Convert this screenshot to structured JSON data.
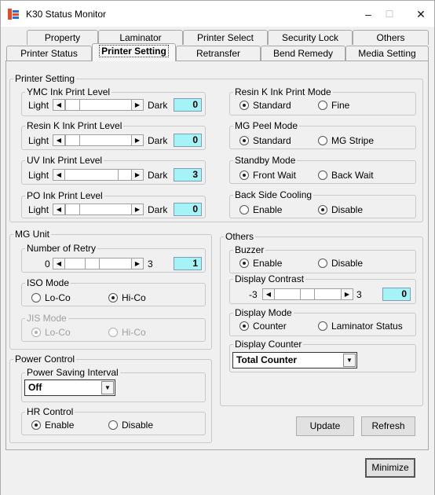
{
  "window": {
    "title": "K30 Status Monitor",
    "minimize_glyph": "–",
    "maximize_glyph": "☐",
    "close_glyph": "✕"
  },
  "tabs_row1": [
    "Property",
    "Laminator",
    "Printer Select",
    "Security Lock",
    "Others"
  ],
  "tabs_row2": [
    "Printer Status",
    "Printer Setting",
    "Retransfer",
    "Bend Remedy",
    "Media Setting"
  ],
  "active_tab": "Printer Setting",
  "printer_setting": {
    "title": "Printer Setting",
    "ymc": {
      "label": "YMC Ink Print Level",
      "left": "Light",
      "right": "Dark",
      "value": "0"
    },
    "resin_k": {
      "label": "Resin K Ink Print Level",
      "left": "Light",
      "right": "Dark",
      "value": "0"
    },
    "uv": {
      "label": "UV Ink Print Level",
      "left": "Light",
      "right": "Dark",
      "value": "3"
    },
    "po": {
      "label": "PO Ink Print Level",
      "left": "Light",
      "right": "Dark",
      "value": "0"
    },
    "resin_k_mode": {
      "label": "Resin K Ink Print Mode",
      "opt1": "Standard",
      "opt2": "Fine",
      "selected": "Standard"
    },
    "mg_peel": {
      "label": "MG Peel Mode",
      "opt1": "Standard",
      "opt2": "MG Stripe",
      "selected": "Standard"
    },
    "standby": {
      "label": "Standby Mode",
      "opt1": "Front Wait",
      "opt2": "Back Wait",
      "selected": "Front Wait"
    },
    "back_cooling": {
      "label": "Back Side Cooling",
      "opt1": "Enable",
      "opt2": "Disable",
      "selected": "Disable"
    }
  },
  "mg_unit": {
    "title": "MG Unit",
    "retry": {
      "label": "Number of Retry",
      "left": "0",
      "right": "3",
      "value": "1"
    },
    "iso": {
      "label": "ISO Mode",
      "opt1": "Lo-Co",
      "opt2": "Hi-Co",
      "selected": "Hi-Co"
    },
    "jis": {
      "label": "JIS Mode",
      "opt1": "Lo-Co",
      "opt2": "Hi-Co",
      "selected": "Lo-Co",
      "disabled": true
    }
  },
  "power_control": {
    "title": "Power Control",
    "saving": {
      "label": "Power Saving Interval",
      "value": "Off"
    },
    "hr": {
      "label": "HR Control",
      "opt1": "Enable",
      "opt2": "Disable",
      "selected": "Enable"
    }
  },
  "others": {
    "title": "Others",
    "buzzer": {
      "label": "Buzzer",
      "opt1": "Enable",
      "opt2": "Disable",
      "selected": "Enable"
    },
    "contrast": {
      "label": "Display Contrast",
      "left": "-3",
      "right": "3",
      "value": "0"
    },
    "display_mode": {
      "label": "Display Mode",
      "opt1": "Counter",
      "opt2": "Laminator Status",
      "selected": "Counter"
    },
    "display_counter": {
      "label": "Display Counter",
      "value": "Total Counter"
    }
  },
  "buttons": {
    "update": "Update",
    "refresh": "Refresh",
    "minimize": "Minimize"
  }
}
